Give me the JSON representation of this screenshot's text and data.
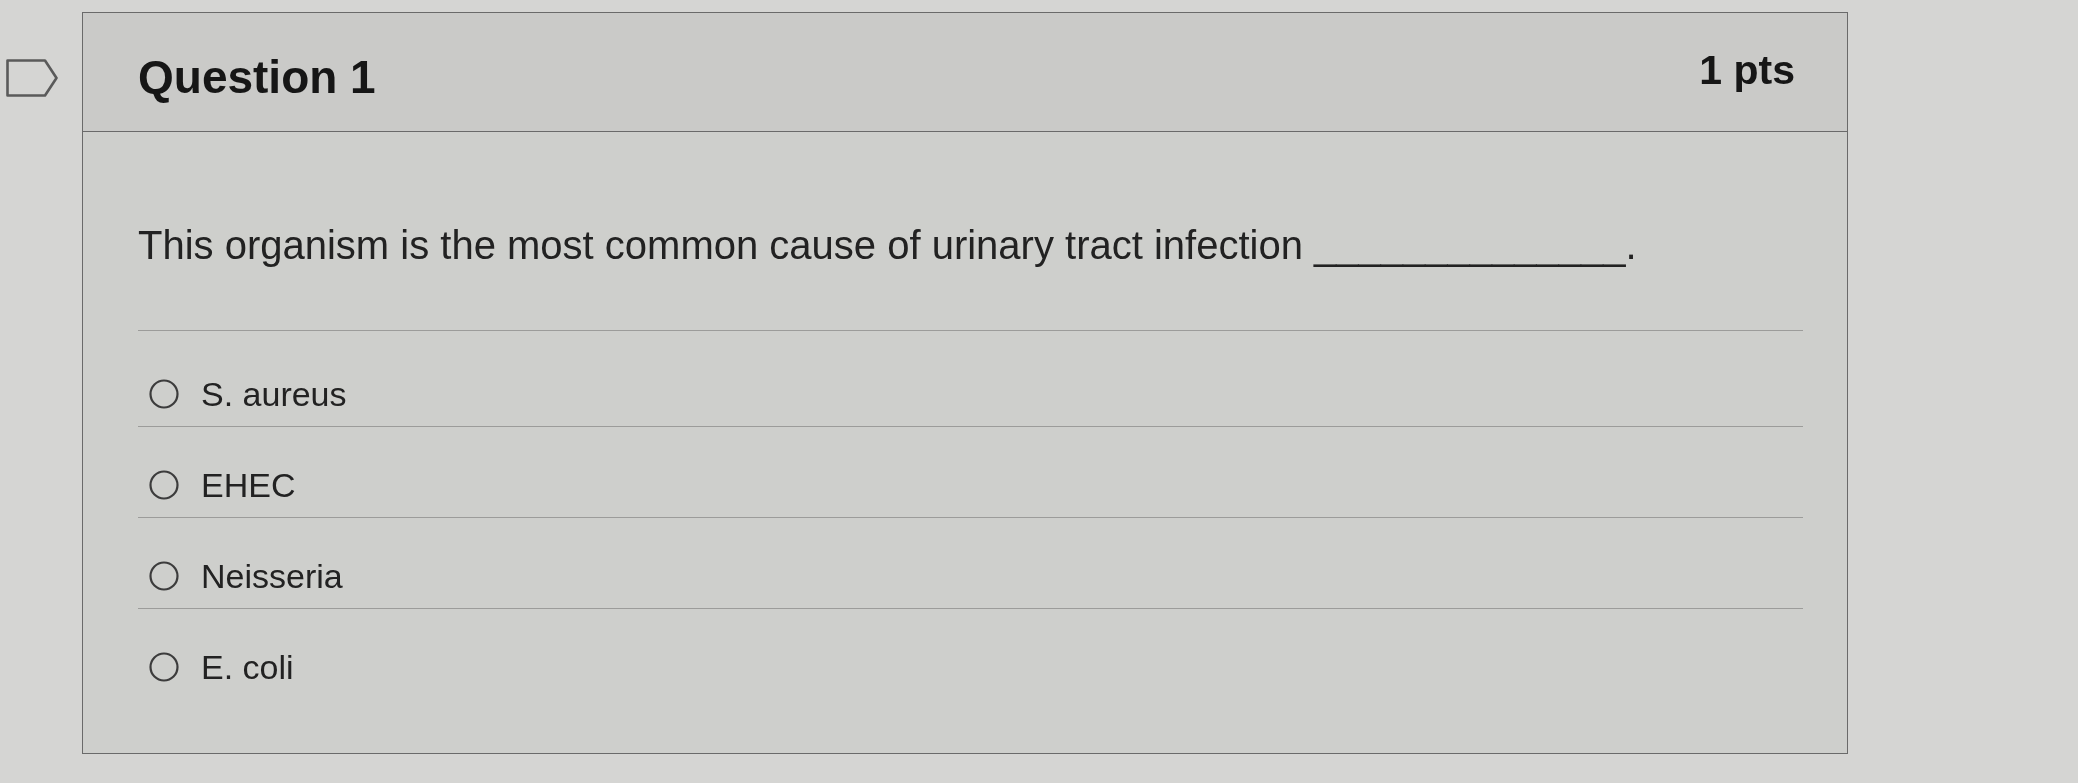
{
  "question": {
    "flagged": false,
    "title": "Question 1",
    "points": "1 pts",
    "text": "This organism is the most common cause of urinary tract infection ______________.",
    "options": [
      {
        "label": "S. aureus",
        "selected": false
      },
      {
        "label": "EHEC",
        "selected": false
      },
      {
        "label": "Neisseria",
        "selected": false
      },
      {
        "label": "E. coli",
        "selected": false
      }
    ]
  }
}
